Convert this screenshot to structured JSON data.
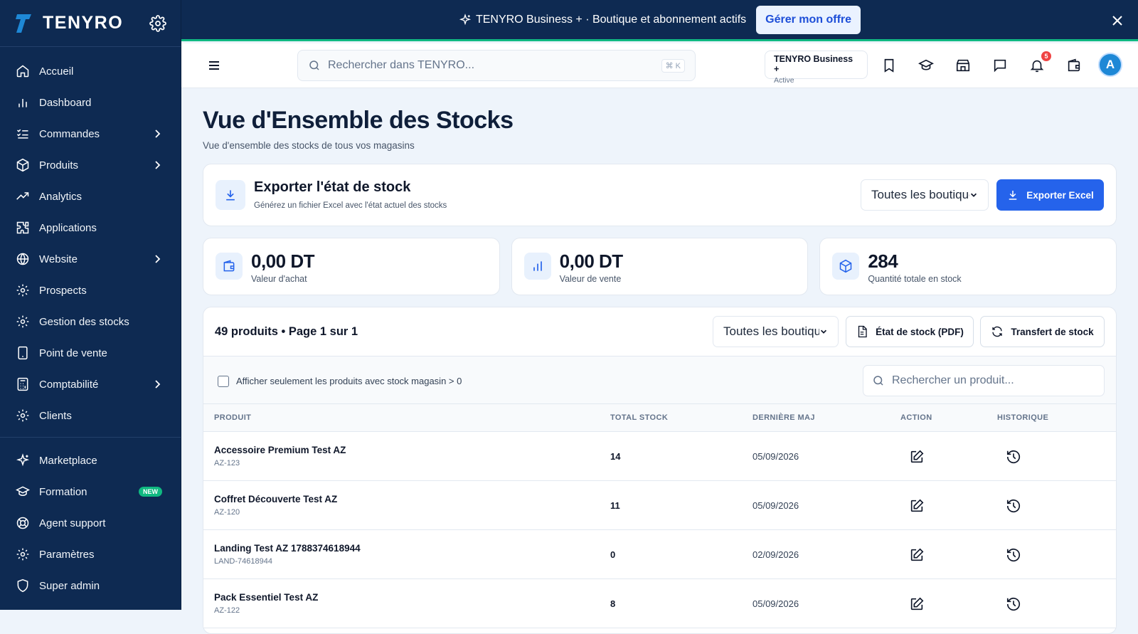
{
  "brand": {
    "name": "TENYRO"
  },
  "sidebar": {
    "items": [
      {
        "label": "Accueil",
        "icon": "home-icon"
      },
      {
        "label": "Dashboard",
        "icon": "bar-chart-icon"
      },
      {
        "label": "Commandes",
        "icon": "list-check-icon",
        "expandable": true
      },
      {
        "label": "Produits",
        "icon": "box-icon",
        "expandable": true
      },
      {
        "label": "Analytics",
        "icon": "trend-icon"
      },
      {
        "label": "Applications",
        "icon": "puzzle-icon"
      },
      {
        "label": "Website",
        "icon": "globe-icon",
        "expandable": true
      },
      {
        "label": "Prospects",
        "icon": "gear-icon"
      },
      {
        "label": "Gestion des stocks",
        "icon": "gear-icon"
      },
      {
        "label": "Point de vente",
        "icon": "tablet-icon"
      },
      {
        "label": "Comptabilité",
        "icon": "calculator-icon",
        "expandable": true
      },
      {
        "label": "Clients",
        "icon": "gear-icon"
      }
    ],
    "bottom_items": [
      {
        "label": "Marketplace",
        "icon": "sparkle-icon"
      },
      {
        "label": "Formation",
        "icon": "graduation-cap-icon",
        "badge": "NEW"
      },
      {
        "label": "Agent support",
        "icon": "lifebuoy-icon"
      },
      {
        "label": "Paramètres",
        "icon": "gear-icon"
      },
      {
        "label": "Super admin",
        "icon": "shield-icon"
      }
    ]
  },
  "banner": {
    "message": "TENYRO Business + · Boutique et abonnement actifs",
    "cta": "Gérer mon offre"
  },
  "header": {
    "search_placeholder": "Rechercher dans TENYRO...",
    "shortcut": "⌘ K",
    "plan_name": "TENYRO Business +",
    "plan_status": "Active",
    "notifications_count": "5",
    "avatar_letter": "A"
  },
  "page": {
    "title": "Vue d'Ensemble des Stocks",
    "subtitle": "Vue d'ensemble des stocks de tous vos magasins"
  },
  "export": {
    "title": "Exporter l'état de stock",
    "description": "Générez un fichier Excel avec l'état actuel des stocks",
    "store_select": "Toutes les boutiques",
    "button": "Exporter Excel"
  },
  "stats": [
    {
      "value": "0,00 DT",
      "label": "Valeur d'achat",
      "icon": "wallet-icon"
    },
    {
      "value": "0,00 DT",
      "label": "Valeur de vente",
      "icon": "bar-chart-icon"
    },
    {
      "value": "284",
      "label": "Quantité totale en stock",
      "icon": "package-icon"
    }
  ],
  "table": {
    "summary": "49 produits • Page 1 sur 1",
    "store_select": "Toutes les boutiques",
    "pdf_button": "État de stock (PDF)",
    "transfer_button": "Transfert de stock",
    "filter_label": "Afficher seulement les produits avec stock magasin > 0",
    "search_placeholder": "Rechercher un produit...",
    "columns": [
      "PRODUIT",
      "TOTAL STOCK",
      "DERNIÈRE MAJ",
      "ACTION",
      "HISTORIQUE"
    ],
    "rows": [
      {
        "name": "Accessoire Premium Test AZ",
        "sku": "AZ-123",
        "stock": "14",
        "updated": "05/09/2026"
      },
      {
        "name": "Coffret Découverte Test AZ",
        "sku": "AZ-120",
        "stock": "11",
        "updated": "05/09/2026"
      },
      {
        "name": "Landing Test AZ 1788374618944",
        "sku": "LAND-74618944",
        "stock": "0",
        "updated": "02/09/2026"
      },
      {
        "name": "Pack Essentiel Test AZ",
        "sku": "AZ-122",
        "stock": "8",
        "updated": "05/09/2026"
      }
    ]
  },
  "colors": {
    "sidebar": "#0e2a52",
    "primary": "#2563eb",
    "accent": "#10b981",
    "page_bg": "#eef4fb"
  }
}
